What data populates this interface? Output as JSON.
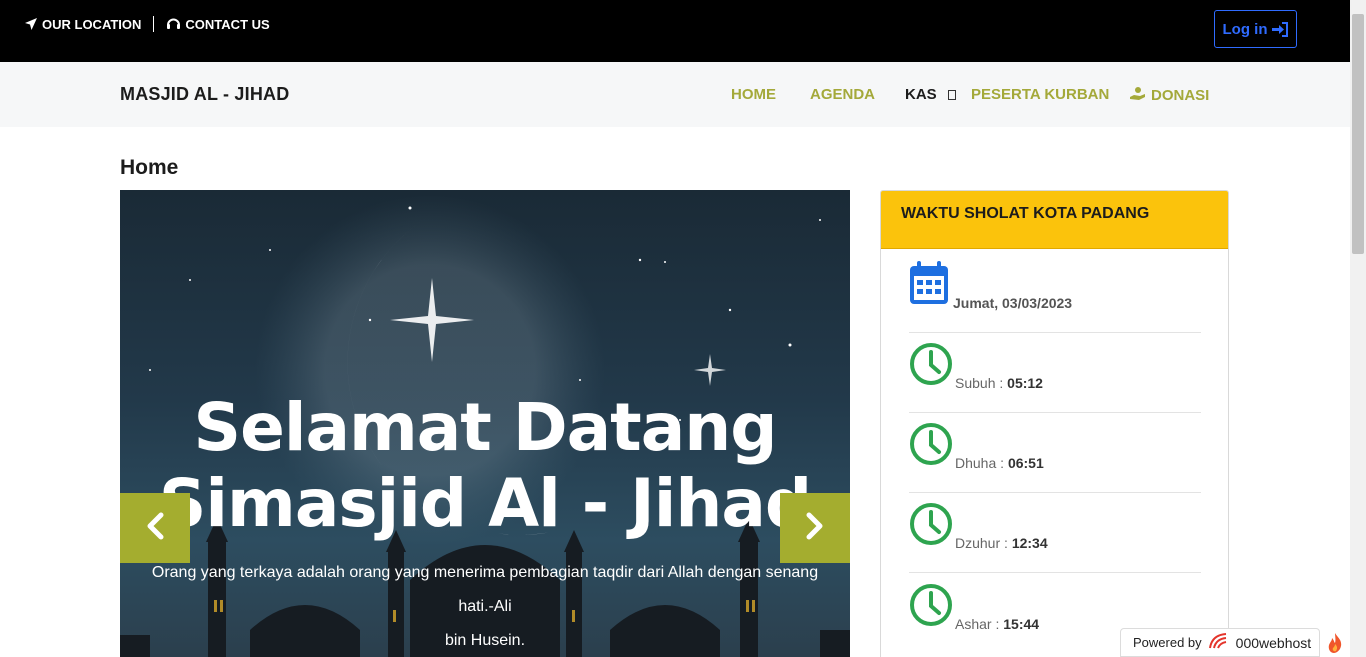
{
  "topbar": {
    "location_label": "OUR LOCATION",
    "contact_label": "CONTACT US",
    "login_label": "Log in"
  },
  "navbar": {
    "brand": "MASJID AL - JIHAD",
    "items": [
      {
        "label": "HOME"
      },
      {
        "label": "AGENDA"
      },
      {
        "label": "KAS"
      },
      {
        "label": "PESERTA KURBAN"
      },
      {
        "label": "DONASI"
      }
    ]
  },
  "page": {
    "title": "Home"
  },
  "carousel": {
    "title_line1": "Selamat Datang",
    "title_line2": "Simasjid Al - Jihad",
    "quote_line1": "Orang yang terkaya adalah orang yang menerima pembagian taqdir dari Allah dengan senang hati.-Ali",
    "quote_line2": "bin Husein."
  },
  "prayer": {
    "heading": "WAKTU SHOLAT KOTA PADANG",
    "date": "Jumat, 03/03/2023",
    "times": [
      {
        "name": "Subuh",
        "time": "05:12"
      },
      {
        "name": "Dhuha",
        "time": "06:51"
      },
      {
        "name": "Dzuhur",
        "time": "12:34"
      },
      {
        "name": "Ashar",
        "time": "15:44"
      }
    ]
  },
  "footer_badge": {
    "powered_label": "Powered by",
    "brand": "000webhost"
  },
  "colors": {
    "accent_olive": "#a4a93a",
    "panel_header": "#fbc30c",
    "login_blue": "#2f6bff",
    "clock_green": "#2ea44f",
    "calendar_blue": "#1e6fe0"
  }
}
